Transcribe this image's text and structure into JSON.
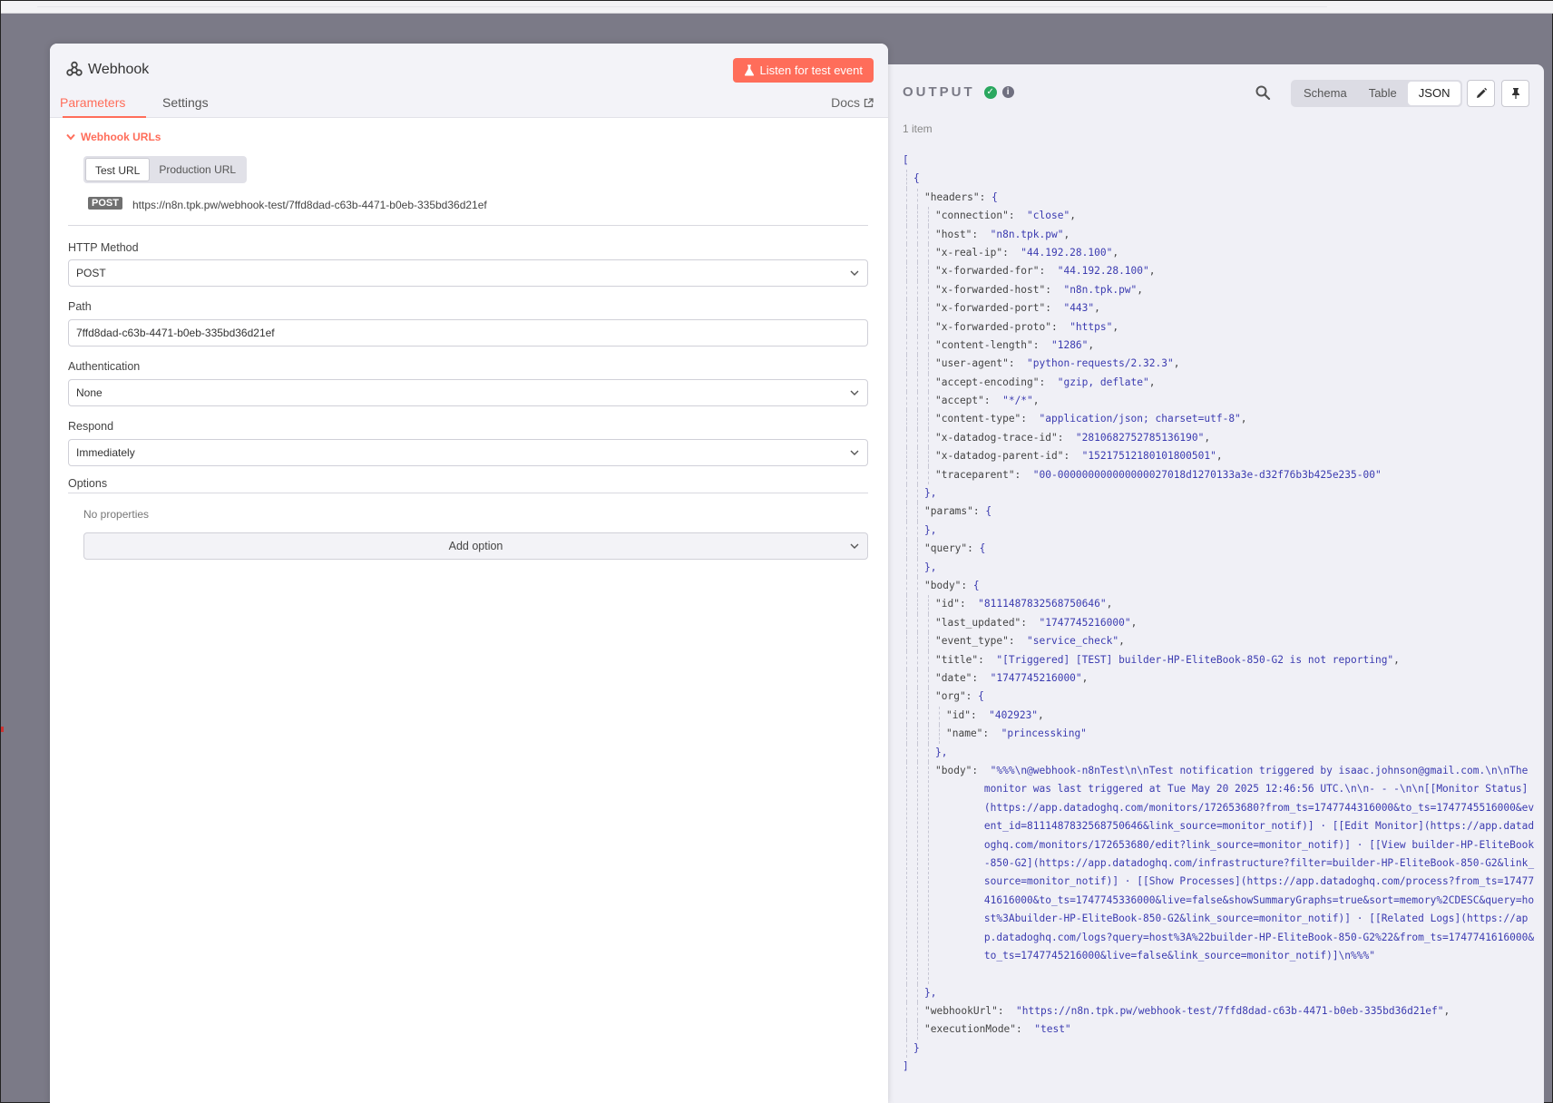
{
  "node": {
    "title": "Webhook",
    "listen_button": "Listen for test event",
    "tabs": [
      "Parameters",
      "Settings"
    ],
    "docs_label": "Docs",
    "webhook_urls": {
      "section_label": "Webhook URLs",
      "toggle": [
        "Test URL",
        "Production URL"
      ],
      "method_badge": "POST",
      "url": "https://n8n.tpk.pw/webhook-test/7ffd8dad-c63b-4471-b0eb-335bd36d21ef"
    },
    "fields": {
      "http_method": {
        "label": "HTTP Method",
        "value": "POST"
      },
      "path": {
        "label": "Path",
        "value": "7ffd8dad-c63b-4471-b0eb-335bd36d21ef"
      },
      "authentication": {
        "label": "Authentication",
        "value": "None"
      },
      "respond": {
        "label": "Respond",
        "value": "Immediately"
      }
    },
    "options": {
      "label": "Options",
      "empty_text": "No properties",
      "add_button": "Add option"
    }
  },
  "output": {
    "title": "OUTPUT",
    "item_count": "1 item",
    "views": [
      "Schema",
      "Table",
      "JSON"
    ],
    "active_view": "JSON",
    "json_lines": [
      {
        "d": 0,
        "t": "["
      },
      {
        "d": 1,
        "t": "{"
      },
      {
        "d": 2,
        "k": "headers",
        "t": "{"
      },
      {
        "d": 3,
        "k": "connection",
        "v": "close",
        "c": true
      },
      {
        "d": 3,
        "k": "host",
        "v": "n8n.tpk.pw",
        "c": true
      },
      {
        "d": 3,
        "k": "x-real-ip",
        "v": "44.192.28.100",
        "c": true
      },
      {
        "d": 3,
        "k": "x-forwarded-for",
        "v": "44.192.28.100",
        "c": true
      },
      {
        "d": 3,
        "k": "x-forwarded-host",
        "v": "n8n.tpk.pw",
        "c": true
      },
      {
        "d": 3,
        "k": "x-forwarded-port",
        "v": "443",
        "c": true
      },
      {
        "d": 3,
        "k": "x-forwarded-proto",
        "v": "https",
        "c": true
      },
      {
        "d": 3,
        "k": "content-length",
        "v": "1286",
        "c": true
      },
      {
        "d": 3,
        "k": "user-agent",
        "v": "python-requests/2.32.3",
        "c": true
      },
      {
        "d": 3,
        "k": "accept-encoding",
        "v": "gzip, deflate",
        "c": true
      },
      {
        "d": 3,
        "k": "accept",
        "v": "*/*",
        "c": true
      },
      {
        "d": 3,
        "k": "content-type",
        "v": "application/json; charset=utf-8",
        "c": true
      },
      {
        "d": 3,
        "k": "x-datadog-trace-id",
        "v": "2810682752785136190",
        "c": true
      },
      {
        "d": 3,
        "k": "x-datadog-parent-id",
        "v": "15217512180101800501",
        "c": true
      },
      {
        "d": 3,
        "k": "traceparent",
        "v": "00-000000000000000027018d1270133a3e-d32f76b3b425e235-00"
      },
      {
        "d": 2,
        "t": "},"
      },
      {
        "d": 2,
        "k": "params",
        "t": "{"
      },
      {
        "d": 2,
        "t": "},"
      },
      {
        "d": 2,
        "k": "query",
        "t": "{"
      },
      {
        "d": 2,
        "t": "},"
      },
      {
        "d": 2,
        "k": "body",
        "t": "{"
      },
      {
        "d": 3,
        "k": "id",
        "v": "8111487832568750646",
        "c": true
      },
      {
        "d": 3,
        "k": "last_updated",
        "v": "1747745216000",
        "c": true
      },
      {
        "d": 3,
        "k": "event_type",
        "v": "service_check",
        "c": true
      },
      {
        "d": 3,
        "k": "title",
        "v": "[Triggered] [TEST] builder-HP-EliteBook-850-G2 is not reporting",
        "c": true
      },
      {
        "d": 3,
        "k": "date",
        "v": "1747745216000",
        "c": true
      },
      {
        "d": 3,
        "k": "org",
        "t": "{"
      },
      {
        "d": 4,
        "k": "id",
        "v": "402923",
        "c": true
      },
      {
        "d": 4,
        "k": "name",
        "v": "princessking"
      },
      {
        "d": 3,
        "t": "},"
      },
      {
        "d": 3,
        "k": "body",
        "v": "%%%\\n@webhook-n8nTest\\n\\nTest notification triggered by isaac.johnson@gmail.com.\\n\\nThe monitor was last triggered at Tue May 20 2025 12:46:56 UTC.\\n\\n- - -\\n\\n[[Monitor Status](https://app.datadoghq.com/monitors/172653680?from_ts=1747744316000&to_ts=1747745516000&event_id=8111487832568750646&link_source=monitor_notif)] · [[Edit Monitor](https://app.datadoghq.com/monitors/172653680/edit?link_source=monitor_notif)] · [[View builder-HP-EliteBook-850-G2](https://app.datadoghq.com/infrastructure?filter=builder-HP-EliteBook-850-G2&link_source=monitor_notif)] · [[Show Processes](https://app.datadoghq.com/process?from_ts=1747741616000&to_ts=1747745336000&live=false&showSummaryGraphs=true&sort=memory%2CDESC&query=host%3Abuilder-HP-EliteBook-850-G2&link_source=monitor_notif)] · [[Related Logs](https://app.datadoghq.com/logs?query=host%3A%22builder-HP-EliteBook-850-G2%22&from_ts=1747741616000&to_ts=1747745216000&live=false&link_source=monitor_notif)]\\n%%%",
        "wrap": true
      },
      {
        "d": 2,
        "t": "},"
      },
      {
        "d": 2,
        "k": "webhookUrl",
        "v": "https://n8n.tpk.pw/webhook-test/7ffd8dad-c63b-4471-b0eb-335bd36d21ef",
        "c": true
      },
      {
        "d": 2,
        "k": "executionMode",
        "v": "test"
      },
      {
        "d": 1,
        "t": "}"
      },
      {
        "d": 0,
        "t": "]"
      }
    ]
  },
  "colors": {
    "accent": "#ff6d5a",
    "success": "#2aa75f",
    "json_string": "#3b3bb0"
  }
}
